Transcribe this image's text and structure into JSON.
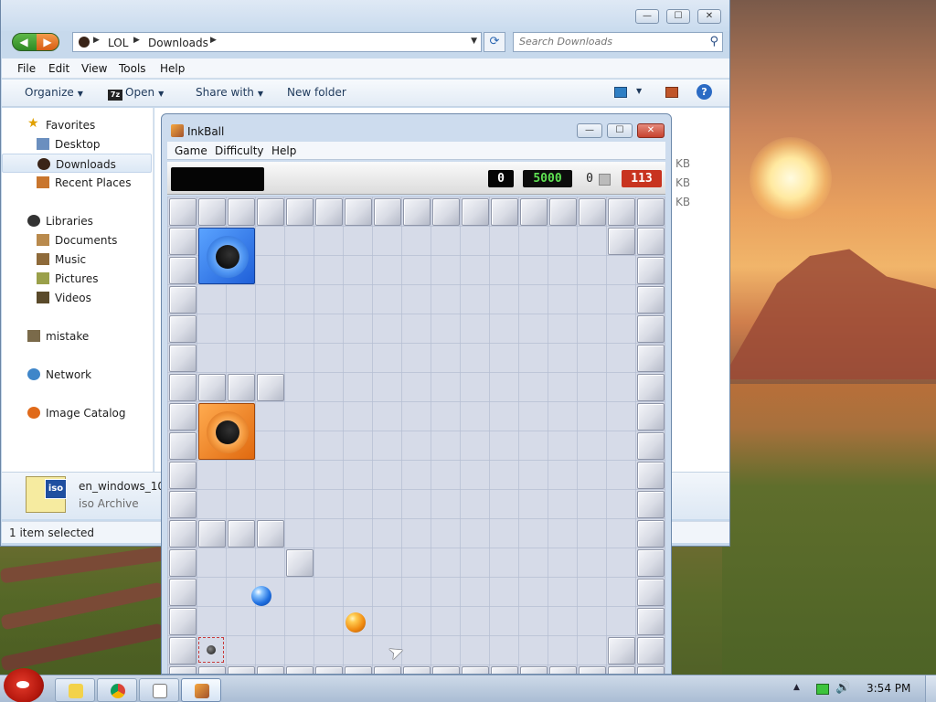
{
  "explorer": {
    "address": {
      "crumbs": [
        "LOL",
        "Downloads"
      ]
    },
    "search": {
      "placeholder": "Search Downloads"
    },
    "menu": [
      "File",
      "Edit",
      "View",
      "Tools",
      "Help"
    ],
    "toolbar": {
      "organize": "Organize",
      "open": "Open",
      "open_icon_text": "7z",
      "share_with": "Share with",
      "new_folder": "New folder"
    },
    "nav": {
      "favorites": "Favorites",
      "favorites_items": [
        "Desktop",
        "Downloads",
        "Recent Places"
      ],
      "libraries": "Libraries",
      "libraries_items": [
        "Documents",
        "Music",
        "Pictures",
        "Videos"
      ],
      "homegroup": "mistake",
      "network": "Network",
      "catalog": "Image Catalog"
    },
    "content": {
      "size_units": [
        "KB",
        "KB",
        "KB"
      ]
    },
    "details": {
      "icon_text": "iso",
      "file_name": "en_windows_10_",
      "file_type": "iso Archive"
    },
    "status": "1 item selected"
  },
  "inkball": {
    "title": "InkBall",
    "menu": [
      "Game",
      "Difficulty",
      "Help"
    ],
    "score": {
      "main": "0",
      "bonus": "5000",
      "lost": "0",
      "timer": "113"
    },
    "colors": {
      "blue_hole": "#2a6fe6",
      "orange_hole": "#f07d1a",
      "timer_bg": "#c8331f",
      "bonus_text": "#5ee052"
    }
  },
  "taskbar": {
    "clock": "3:54 PM",
    "apps": [
      "file-explorer-icon",
      "chrome-icon",
      "solitaire-icon",
      "inkball-icon"
    ]
  },
  "icons": {
    "title_controls": {
      "minimize": "—",
      "maximize": "☐",
      "close": "✕"
    },
    "back": "◀",
    "forward": "▶",
    "refresh": "⟳",
    "search": "⚲",
    "help": "?"
  }
}
